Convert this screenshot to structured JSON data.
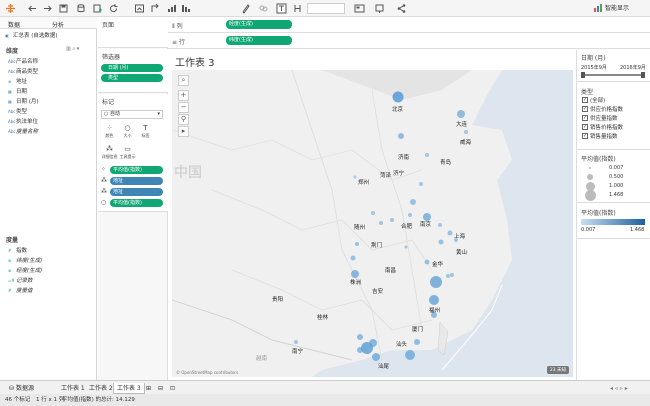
{
  "toolbar": {
    "smart_label": "智能显示"
  },
  "datapane": {
    "tabs": [
      "数据",
      "分析"
    ],
    "datasource": "汇总表 (自选数据)",
    "dimensions_header": "维度",
    "dimensions": [
      {
        "icon": "Abc",
        "label": "产品名称",
        "italic": false
      },
      {
        "icon": "Abc",
        "label": "商品类型",
        "italic": false
      },
      {
        "icon": "⊕",
        "label": "地址",
        "italic": false
      },
      {
        "icon": "▦",
        "label": "日期",
        "italic": false
      },
      {
        "icon": "▦",
        "label": "日期 (月)",
        "italic": false
      },
      {
        "icon": "Abc",
        "label": "类型",
        "italic": false
      },
      {
        "icon": "Abc",
        "label": "执法单位",
        "italic": false
      },
      {
        "icon": "Abc",
        "label": "度量名称",
        "italic": true
      }
    ],
    "measures_header": "度量",
    "measures": [
      {
        "icon": "#",
        "label": "指数",
        "italic": false
      },
      {
        "icon": "⊕",
        "label": "纬度(生成)",
        "italic": true
      },
      {
        "icon": "⊕",
        "label": "经度(生成)",
        "italic": true
      },
      {
        "icon": "=#",
        "label": "记录数",
        "italic": true
      },
      {
        "icon": "#",
        "label": "度量值",
        "italic": true
      }
    ]
  },
  "pages_label": "页面",
  "filters": {
    "title": "筛选器",
    "pills": [
      "日期 (月)",
      "类型"
    ]
  },
  "marks": {
    "title": "标记",
    "type": "自动",
    "buttons": [
      {
        "glyph": "⁘",
        "label": "颜色"
      },
      {
        "glyph": "○",
        "label": "大小"
      },
      {
        "glyph": "T",
        "label": "标签"
      },
      {
        "glyph": "⁂",
        "label": "详细信息"
      },
      {
        "glyph": "▭",
        "label": "工具提示"
      }
    ],
    "pills": [
      {
        "icon": "⁘",
        "label": "平均值(指数)",
        "color": "green"
      },
      {
        "icon": "⁂",
        "label": "地址",
        "color": "blue"
      },
      {
        "icon": "⁂",
        "label": "地址",
        "color": "blue"
      },
      {
        "icon": "○",
        "label": "平均值(指数)",
        "color": "green"
      }
    ]
  },
  "shelves": {
    "columns_label": "列",
    "columns_pill": "经度(生成)",
    "rows_label": "行",
    "rows_pill": "纬度(生成)"
  },
  "view": {
    "title": "工作表 3",
    "country_label": "中国",
    "copyright": "© OpenStreetMap contributors",
    "mapmode": "23 未知",
    "cities": [
      "北京",
      "大连",
      "威海",
      "济南",
      "青岛",
      "菏泽",
      "济宁",
      "郑州",
      "合肥",
      "南京",
      "上海",
      "随州",
      "荆门",
      "黄山",
      "金华",
      "南昌",
      "株洲",
      "吉安",
      "贵阳",
      "福州",
      "厦门",
      "桂林",
      "南宁",
      "汕头",
      "汕尾",
      "越南"
    ]
  },
  "legends": {
    "date_title": "日期 (月)",
    "date_start": "2015年9月",
    "date_end": "2016年9月",
    "type_title": "类型",
    "type_items": [
      "(全部)",
      "供应价格指数",
      "供应量指数",
      "销售价格指数",
      "销售量指数"
    ],
    "size_title": "平均值(指数)",
    "size_items": [
      "0.007",
      "0.500",
      "1.000",
      "1.468"
    ],
    "color_title": "平均值(指数)",
    "color_min": "0.007",
    "color_max": "1.468"
  },
  "sheettabs": [
    "数据源",
    "工作表 1",
    "工作表 2",
    "工作表 3"
  ],
  "status": [
    "46 个标记",
    "1 行 x 1 列",
    "平均值(指数) 的总计: 14.129"
  ],
  "colors": {
    "green": "#0fa774",
    "blue": "#3f86b5",
    "bubble": "#5b9fd6"
  }
}
